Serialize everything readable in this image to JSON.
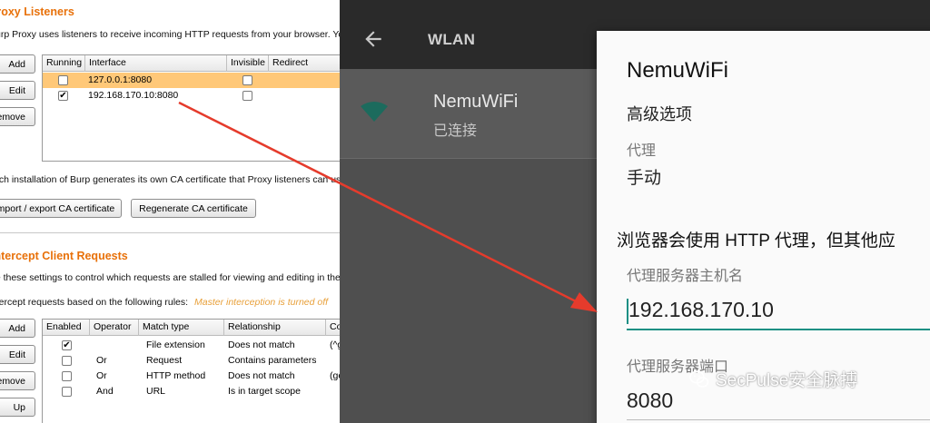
{
  "burp": {
    "listeners_title": "Proxy Listeners",
    "listeners_desc": "Burp Proxy uses listeners to receive incoming HTTP requests from your browser. You",
    "listener_buttons": [
      "Add",
      "Edit",
      "Remove"
    ],
    "listener_columns": [
      "Running",
      "Interface",
      "Invisible",
      "Redirect"
    ],
    "listener_rows": [
      {
        "running": false,
        "interface": "127.0.0.1:8080",
        "invisible": false,
        "selected": true
      },
      {
        "running": true,
        "interface": "192.168.170.10:8080",
        "invisible": false,
        "selected": false
      }
    ],
    "ca_desc": "Each installation of Burp generates its own CA certificate that Proxy listeners can us",
    "import_export_label": "Import / export CA certificate",
    "regenerate_label": "Regenerate CA certificate",
    "intercept_title": "Intercept Client Requests",
    "intercept_desc": "Use these settings to control which requests are stalled for viewing and editing in the",
    "intercept_rules_prefix": "Intercept requests based on the following rules:",
    "intercept_status": "Master interception is turned off",
    "rule_buttons": [
      "Add",
      "Edit",
      "Remove",
      "Up"
    ],
    "rule_columns": [
      "Enabled",
      "Operator",
      "Match type",
      "Relationship",
      "Co"
    ],
    "rule_rows": [
      {
        "enabled": true,
        "operator": "",
        "match_type": "File extension",
        "relationship": "Does not match",
        "condition": "(^g"
      },
      {
        "enabled": false,
        "operator": "Or",
        "match_type": "Request",
        "relationship": "Contains parameters",
        "condition": ""
      },
      {
        "enabled": false,
        "operator": "Or",
        "match_type": "HTTP method",
        "relationship": "Does not match",
        "condition": "(ge"
      },
      {
        "enabled": false,
        "operator": "And",
        "match_type": "URL",
        "relationship": "Is in target scope",
        "condition": ""
      }
    ],
    "accent_color": "#e8710a",
    "selection_color": "#ffc878"
  },
  "android": {
    "appbar_title": "WLAN",
    "back_icon": "arrow-back-icon",
    "network_name": "NemuWiFi",
    "network_status": "已连接",
    "wifi_icon": "wifi-signal-icon",
    "dialog": {
      "title": "NemuWiFi",
      "advanced_options": "高级选项",
      "proxy_label": "代理",
      "proxy_value": "手动",
      "notice": "浏览器会使用 HTTP 代理，但其他应",
      "host_label": "代理服务器主机名",
      "host_value": "192.168.170.10",
      "port_label": "代理服务器端口",
      "port_value": "8080"
    },
    "accent_color": "#1a8f84"
  },
  "watermark": {
    "text": "SecPulse安全脉搏",
    "icon": "wechat-icon"
  },
  "annotation": {
    "arrow_color": "#e53b2c"
  }
}
